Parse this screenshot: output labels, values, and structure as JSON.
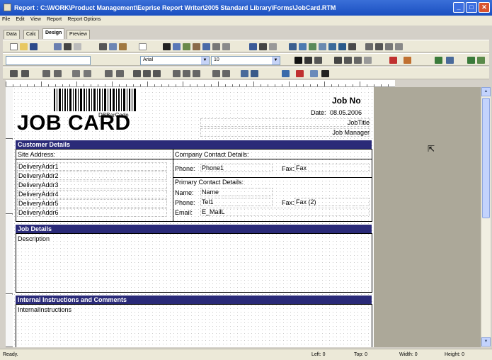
{
  "window": {
    "title": "Report : C:\\WORK\\Product Management\\Eeprise Report Writer\\2005 Standard Library\\Forms\\JobCard.RTM",
    "controls": [
      "minimize",
      "maximize",
      "close"
    ]
  },
  "menu": [
    "File",
    "Edit",
    "View",
    "Report",
    "Report Options"
  ],
  "tabs": [
    "Data",
    "Calc",
    "Design",
    "Preview"
  ],
  "active_tab": "Design",
  "format": {
    "font_name": "Arial",
    "font_size": "10"
  },
  "report": {
    "job_no_label": "Job No",
    "date_label": "Date:",
    "date_value": "08.05.2006",
    "job_title": "JobTitle",
    "job_manager": "Job Manager",
    "dbbarcode": "DBBarCode",
    "title": "JOB CARD",
    "customer_details": "Customer Details",
    "site_address": "Site Address:",
    "addresses": [
      "DeliveryAddr1",
      "DeliveryAddr2",
      "DeliveryAddr3",
      "DeliveryAddr4",
      "DeliveryAddr5",
      "DeliveryAddr6"
    ],
    "company_contact": "Company Contact Details:",
    "phone_label": "Phone:",
    "phone_value": "Phone1",
    "fax_label": "Fax:",
    "fax_value": "Fax",
    "primary_contact": "Primary Contact Details:",
    "name_label": "Name:",
    "name_value": "Name",
    "phone2_label": "Phone:",
    "phone2_value": "Tel1",
    "fax2_label": "Fax:",
    "fax2_value": "Fax (2)",
    "email_label": "Email:",
    "email_value": "E_MailL",
    "job_details": "Job Details",
    "description": "Description",
    "internal_header": "Internal Instructions and Comments",
    "internal_instructions": "InternalInstructions"
  },
  "status": {
    "state": "Ready.",
    "left": "Left: 0",
    "top": "Top: 0",
    "width": "Width: 0",
    "height": "Height: 0"
  },
  "colors": {
    "band_header": "#2a2a78",
    "titlebar": "#1a4fc0"
  }
}
